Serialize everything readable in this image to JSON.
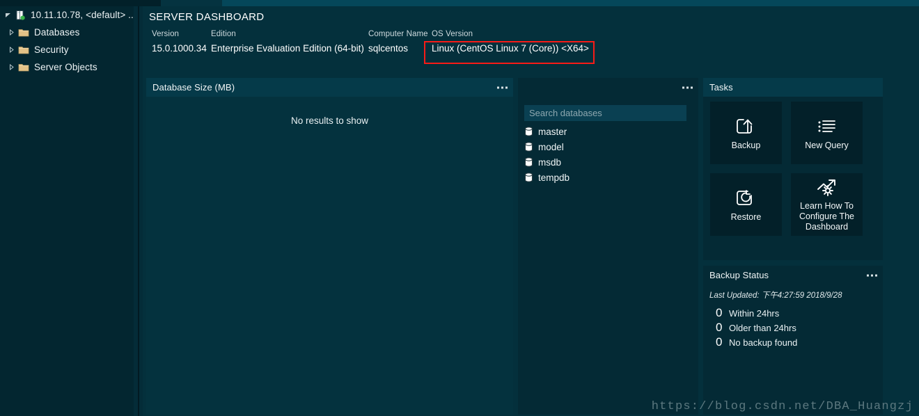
{
  "sidebar": {
    "server_node": {
      "label": "10.11.10.78, <default> ...",
      "icon": "server-icon",
      "status": "connected"
    },
    "items": [
      {
        "label": "Databases",
        "icon": "folder-icon"
      },
      {
        "label": "Security",
        "icon": "folder-icon"
      },
      {
        "label": "Server Objects",
        "icon": "folder-icon"
      }
    ]
  },
  "header": {
    "title": "SERVER DASHBOARD",
    "properties": [
      {
        "label": "Version",
        "value": "15.0.1000.34"
      },
      {
        "label": "Edition",
        "value": "Enterprise Evaluation Edition (64-bit)"
      },
      {
        "label": "Computer Name",
        "value": "sqlcentos"
      },
      {
        "label": "OS Version",
        "value": "Linux (CentOS Linux 7 (Core)) <X64>"
      }
    ],
    "highlight_color": "#f81b17"
  },
  "database_size_panel": {
    "title": "Database Size (MB)",
    "empty_message": "No results to show",
    "menu": "..."
  },
  "database_list_panel": {
    "title": "",
    "menu": "...",
    "search": {
      "placeholder": "Search databases",
      "value": ""
    },
    "databases": [
      {
        "name": "master",
        "icon": "database-icon"
      },
      {
        "name": "model",
        "icon": "database-icon"
      },
      {
        "name": "msdb",
        "icon": "database-icon"
      },
      {
        "name": "tempdb",
        "icon": "database-icon"
      }
    ]
  },
  "tasks_panel": {
    "title": "Tasks",
    "tiles": [
      {
        "label": "Backup",
        "icon": "backup-icon"
      },
      {
        "label": "New Query",
        "icon": "new-query-icon"
      },
      {
        "label": "Restore",
        "icon": "restore-icon"
      },
      {
        "label": "Learn How To Configure The Dashboard",
        "icon": "configure-dashboard-icon"
      }
    ]
  },
  "backup_status_panel": {
    "title": "Backup Status",
    "menu": "...",
    "last_updated": "Last Updated: 下午4:27:59 2018/9/28",
    "counts": [
      {
        "count": "0",
        "label": "Within 24hrs"
      },
      {
        "count": "0",
        "label": "Older than 24hrs"
      },
      {
        "count": "0",
        "label": "No backup found"
      }
    ]
  },
  "watermark": "https://blog.csdn.net/DBA_Huangzj"
}
